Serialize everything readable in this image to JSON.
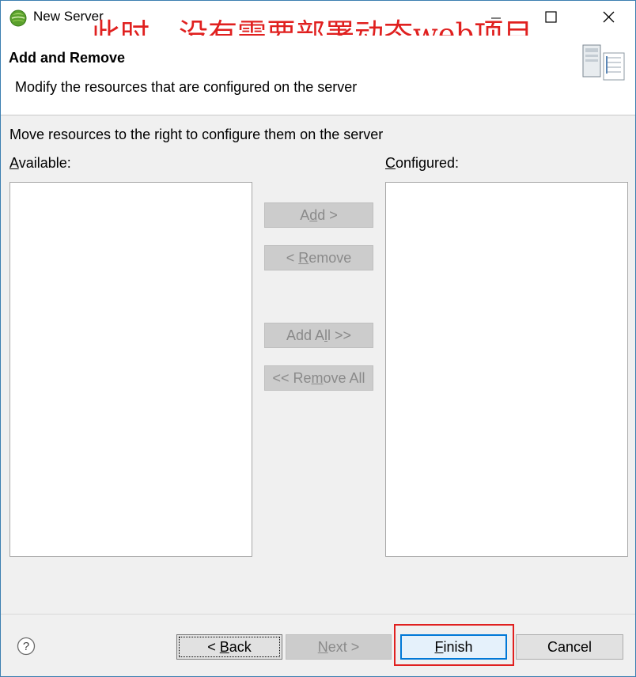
{
  "window": {
    "title": "New Server",
    "icons": {
      "app": "eclipse-icon",
      "minimize": "minimize-icon",
      "maximize": "maximize-icon",
      "close": "close-icon"
    }
  },
  "annotation": {
    "text": "此时，没有需要部署动态web项目",
    "color": "#e0201f"
  },
  "header": {
    "title": "Add and Remove",
    "description": "Modify the resources that are configured on the server",
    "icon": "server-icon"
  },
  "instruction": "Move resources to the right to configure them on the server",
  "available": {
    "mnemonic": "A",
    "label_rest": "vailable:",
    "items": []
  },
  "configured": {
    "mnemonic": "C",
    "label_rest": "onfigured:",
    "items": []
  },
  "move_buttons": {
    "add": {
      "pre": "A",
      "mn": "d",
      "post": "d >"
    },
    "remove": {
      "pre": "< ",
      "mn": "R",
      "post": "emove"
    },
    "add_all": {
      "pre": "Add A",
      "mn": "l",
      "post": "l >>"
    },
    "remove_all": {
      "pre": "<< Re",
      "mn": "m",
      "post": "ove All"
    }
  },
  "footer": {
    "help_icon": "help-icon",
    "back": {
      "pre": "< ",
      "mn": "B",
      "post": "ack"
    },
    "next": {
      "pre": "",
      "mn": "N",
      "post": "ext >"
    },
    "finish": {
      "pre": "",
      "mn": "F",
      "post": "inish"
    },
    "cancel": "Cancel"
  },
  "colors": {
    "accent": "#0078d7",
    "highlight": "#e0201f",
    "disabled_text": "#8a8a8a"
  }
}
